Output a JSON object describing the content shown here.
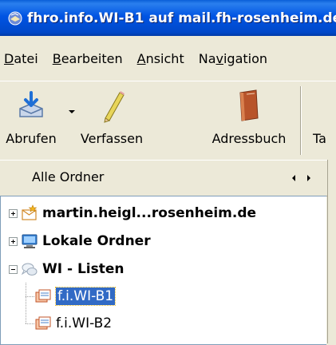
{
  "window": {
    "title": "fhro.info.WI-B1 auf mail.fh-rosenheim.de",
    "app_icon": "thunderbird-icon"
  },
  "menubar": {
    "items": [
      {
        "label_accel": "D",
        "label_rest": "atei"
      },
      {
        "label_accel": "B",
        "label_rest": "earbeiten"
      },
      {
        "label_accel": "A",
        "label_rest": "nsicht"
      },
      {
        "label_pre": "Na",
        "label_accel": "v",
        "label_rest": "igation"
      }
    ]
  },
  "toolbar": {
    "buttons": [
      {
        "label": "Abrufen",
        "icon": "get-mail-icon"
      },
      {
        "label": "Verfassen",
        "icon": "pencil-icon"
      },
      {
        "label": "Adressbuch",
        "icon": "address-book-icon"
      },
      {
        "label": "Ta",
        "icon": "tag-icon"
      }
    ]
  },
  "folder_pane": {
    "header": "Alle Ordner"
  },
  "tree": {
    "items": [
      {
        "label": "martin.heigl...rosenheim.de",
        "icon": "mail-account-icon",
        "expander": "plus",
        "bold": true
      },
      {
        "label": "Lokale Ordner",
        "icon": "local-folders-icon",
        "expander": "plus",
        "bold": true
      },
      {
        "label": "WI - Listen",
        "icon": "news-server-icon",
        "expander": "minus",
        "bold": true
      },
      {
        "label": "f.i.WI-B1",
        "icon": "newsgroup-icon",
        "selected": true
      },
      {
        "label": "f.i.WI-B2",
        "icon": "newsgroup-icon"
      }
    ]
  },
  "colors": {
    "titlebar": "#0054e3",
    "chrome": "#ece9d8",
    "selection": "#316ac5"
  }
}
